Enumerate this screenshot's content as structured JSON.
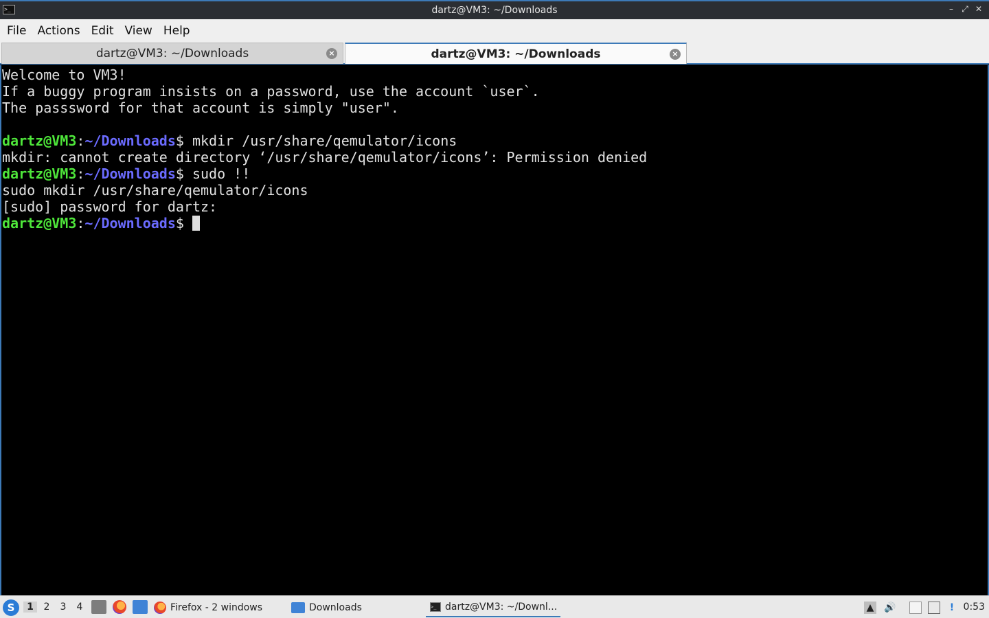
{
  "window": {
    "title": "dartz@VM3: ~/Downloads",
    "app_icon": ">_",
    "minimize": "–",
    "maximize": "⤢",
    "close": "✕"
  },
  "menu": [
    "File",
    "Actions",
    "Edit",
    "View",
    "Help"
  ],
  "tabs": [
    {
      "label": "dartz@VM3: ~/Downloads",
      "active": false
    },
    {
      "label": "dartz@VM3: ~/Downloads",
      "active": true
    }
  ],
  "terminal": {
    "welcome": [
      "Welcome to VM3!",
      "If a buggy program insists on a password, use the account `user`.",
      "The passsword for that account is simply \"user\"."
    ],
    "prompt_user": "dartz@VM3",
    "prompt_sep": ":",
    "prompt_path": "~/Downloads",
    "prompt_end": "$ ",
    "cmd1": "mkdir /usr/share/qemulator/icons",
    "out1": "mkdir: cannot create directory ‘/usr/share/qemulator/icons’: Permission denied",
    "cmd2": "sudo !!",
    "out2": "sudo mkdir /usr/share/qemulator/icons",
    "out3": "[sudo] password for dartz:"
  },
  "taskbar": {
    "workspaces": [
      "1",
      "2",
      "3",
      "4"
    ],
    "current_workspace": "1",
    "tasks": [
      {
        "label": "Firefox - 2 windows",
        "icon": "firefox-icon"
      },
      {
        "label": "Downloads",
        "icon": "folder-icon"
      },
      {
        "label": "dartz@VM3: ~/Downl...",
        "icon": "terminal-icon"
      }
    ],
    "clock": "0:53"
  }
}
